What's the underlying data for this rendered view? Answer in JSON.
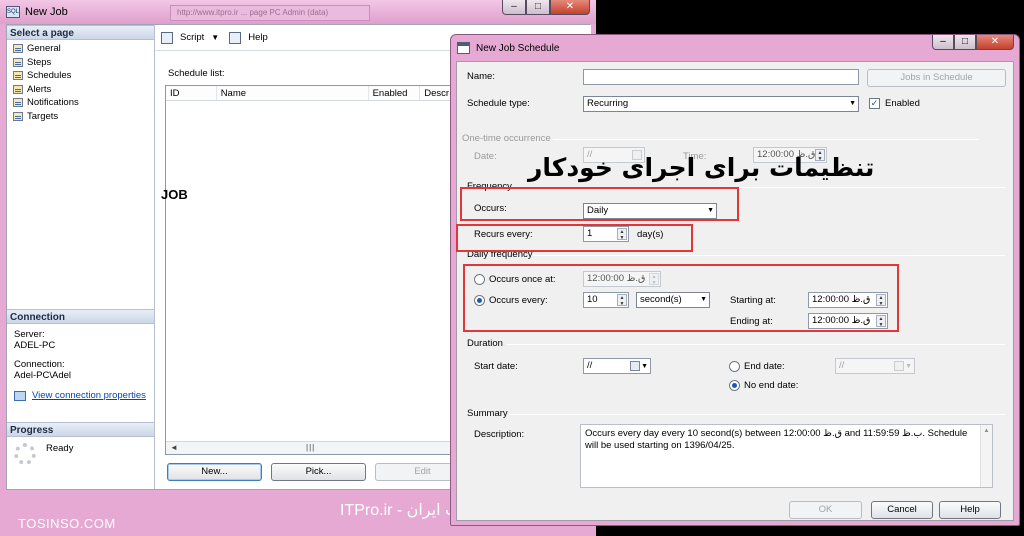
{
  "job_window": {
    "title": "New Job",
    "background_tab": "http://www.itpro.ir ... page PC Admin (data)",
    "left_pane": {
      "select_page_header": "Select a page",
      "pages": [
        "General",
        "Steps",
        "Schedules",
        "Alerts",
        "Notifications",
        "Targets"
      ],
      "connection_header": "Connection",
      "server_label": "Server:",
      "server_value": "ADEL-PC",
      "connection_label": "Connection:",
      "connection_value": "Adel-PC\\Adel",
      "view_connection_link": "View connection properties",
      "progress_header": "Progress",
      "progress_status": "Ready"
    },
    "toolbar": {
      "script_label": "Script",
      "help_label": "Help"
    },
    "schedule_list_label": "Schedule list:",
    "columns": [
      "ID",
      "Name",
      "Enabled",
      "Descr"
    ],
    "annotation_job": "JOB",
    "buttons": {
      "new": "New...",
      "pick": "Pick...",
      "edit": "Edit"
    }
  },
  "schedule_window": {
    "title": "New Job Schedule",
    "name_label": "Name:",
    "name_value": "",
    "jobs_in_schedule_button": "Jobs in Schedule",
    "schedule_type_label": "Schedule type:",
    "schedule_type_value": "Recurring",
    "enabled_label": "Enabled",
    "enabled_checked": true,
    "one_time": {
      "group_label": "One-time occurrence",
      "date_label": "Date:",
      "date_value": "//",
      "time_label": "Time:",
      "time_value": "12:00:00 ق.ظ"
    },
    "frequency": {
      "group_label": "Frequency",
      "occurs_label": "Occurs:",
      "occurs_value": "Daily",
      "recurs_label": "Recurs every:",
      "recurs_value": "1",
      "recurs_unit": "day(s)"
    },
    "daily_frequency": {
      "group_label": "Daily frequency",
      "occurs_once_label": "Occurs once at:",
      "occurs_once_value": "12:00:00 ق.ظ",
      "occurs_every_label": "Occurs every:",
      "occurs_every_value": "10",
      "occurs_every_unit": "second(s)",
      "starting_at_label": "Starting at:",
      "starting_at_value": "12:00:00 ق.ظ",
      "ending_at_label": "Ending at:",
      "ending_at_value": "12:00:00 ق.ظ",
      "selected": "occurs_every"
    },
    "duration": {
      "group_label": "Duration",
      "start_date_label": "Start date:",
      "start_date_value": "//",
      "end_date_label": "End date:",
      "end_date_value": "//",
      "no_end_date_label": "No end date:",
      "selected": "no_end_date"
    },
    "summary": {
      "group_label": "Summary",
      "description_label": "Description:",
      "description_value": "Occurs every day every 10 second(s) between 12:00:00 ق.ظ and 11:59:59 ب.ظ. Schedule will be used starting on 1396/04/25."
    },
    "buttons": {
      "ok": "OK",
      "cancel": "Cancel",
      "help": "Help"
    }
  },
  "overlay": {
    "persian_title": "تنظیمات برای اجرای خودکار",
    "annotation_color": "#e03838"
  },
  "watermarks": {
    "left": "TOSINSO.COM",
    "right": "ITPro.ir - وب سایت تخصصی فناوری اطلاعات ایران"
  }
}
